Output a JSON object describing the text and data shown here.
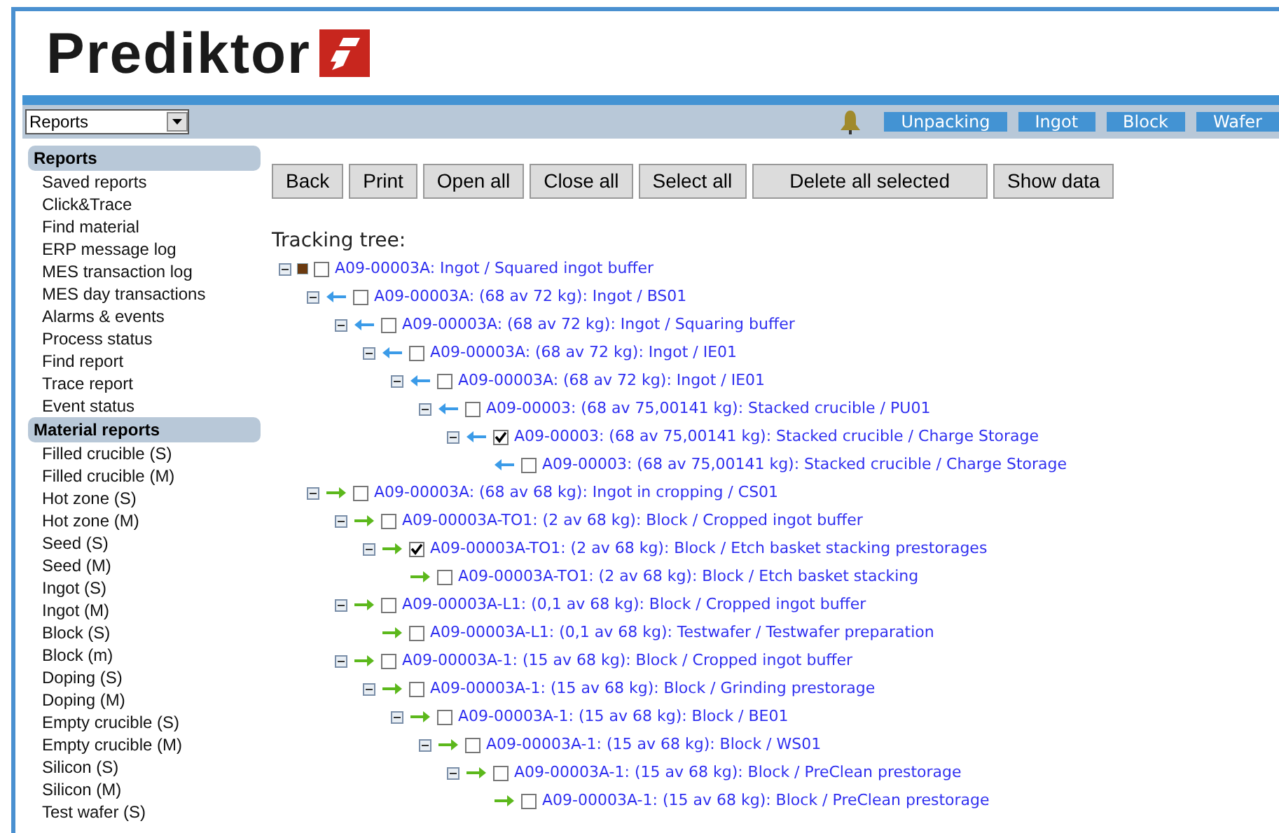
{
  "logo": {
    "text": "Prediktor"
  },
  "view_select": {
    "value": "Reports"
  },
  "nav_tabs": [
    {
      "label": "Unpacking"
    },
    {
      "label": "Ingot"
    },
    {
      "label": "Block"
    },
    {
      "label": "Wafer"
    }
  ],
  "sidebar": {
    "sections": [
      {
        "title": "Reports",
        "items": [
          "Saved reports",
          "Click&Trace",
          "Find material",
          "ERP message log",
          "MES transaction log",
          "MES day transactions",
          "Alarms & events",
          "Process status",
          "Find report",
          "Trace report",
          "Event status"
        ]
      },
      {
        "title": "Material reports",
        "items": [
          "Filled crucible (S)",
          "Filled crucible (M)",
          "Hot zone (S)",
          "Hot zone (M)",
          "Seed (S)",
          "Seed (M)",
          "Ingot (S)",
          "Ingot (M)",
          "Block (S)",
          "Block (m)",
          "Doping (S)",
          "Doping (M)",
          "Empty crucible (S)",
          "Empty crucible (M)",
          "Silicon (S)",
          "Silicon (M)",
          "Test wafer (S)"
        ]
      }
    ]
  },
  "toolbar": [
    "Back",
    "Print",
    "Open all",
    "Close all",
    "Select all",
    "Delete all selected",
    "Show data"
  ],
  "tracking_tree": {
    "title": "Tracking tree:",
    "nodes": [
      {
        "kind": "root",
        "checked": false,
        "label": "A09-00003A: Ingot / Squared ingot buffer",
        "children": [
          {
            "kind": "incoming",
            "checked": false,
            "label": "A09-00003A: (68 av 72 kg): Ingot / BS01",
            "children": [
              {
                "kind": "incoming",
                "checked": false,
                "label": "A09-00003A: (68 av 72 kg): Ingot / Squaring buffer",
                "children": [
                  {
                    "kind": "incoming",
                    "checked": false,
                    "label": "A09-00003A: (68 av 72 kg): Ingot / IE01",
                    "children": [
                      {
                        "kind": "incoming",
                        "checked": false,
                        "label": "A09-00003A: (68 av 72 kg): Ingot / IE01",
                        "children": [
                          {
                            "kind": "incoming",
                            "checked": false,
                            "label": "A09-00003: (68 av 75,00141 kg): Stacked crucible / PU01",
                            "children": [
                              {
                                "kind": "incoming",
                                "checked": true,
                                "label": "A09-00003: (68 av 75,00141 kg): Stacked crucible / Charge Storage",
                                "children": [
                                  {
                                    "kind": "incoming",
                                    "checked": false,
                                    "label": "A09-00003: (68 av 75,00141 kg): Stacked crucible / Charge Storage"
                                  }
                                ]
                              }
                            ]
                          }
                        ]
                      }
                    ]
                  }
                ]
              }
            ]
          },
          {
            "kind": "outgoing",
            "checked": false,
            "label": "A09-00003A: (68 av 68 kg): Ingot in cropping / CS01",
            "children": [
              {
                "kind": "outgoing",
                "checked": false,
                "label": "A09-00003A-TO1: (2 av 68 kg): Block / Cropped ingot buffer",
                "children": [
                  {
                    "kind": "outgoing",
                    "checked": true,
                    "label": "A09-00003A-TO1: (2 av 68 kg): Block / Etch basket stacking prestorages",
                    "children": [
                      {
                        "kind": "outgoing",
                        "checked": false,
                        "label": "A09-00003A-TO1: (2 av 68 kg): Block / Etch basket stacking"
                      }
                    ]
                  }
                ]
              },
              {
                "kind": "outgoing",
                "checked": false,
                "label": "A09-00003A-L1: (0,1 av 68 kg): Block / Cropped ingot buffer",
                "children": [
                  {
                    "kind": "outgoing",
                    "checked": false,
                    "label": "A09-00003A-L1: (0,1 av 68 kg): Testwafer / Testwafer preparation"
                  }
                ]
              },
              {
                "kind": "outgoing",
                "checked": false,
                "label": "A09-00003A-1: (15 av 68 kg): Block / Cropped ingot buffer",
                "children": [
                  {
                    "kind": "outgoing",
                    "checked": false,
                    "label": "A09-00003A-1: (15 av 68 kg): Block / Grinding prestorage",
                    "children": [
                      {
                        "kind": "outgoing",
                        "checked": false,
                        "label": "A09-00003A-1: (15 av 68 kg): Block / BE01",
                        "children": [
                          {
                            "kind": "outgoing",
                            "checked": false,
                            "label": "A09-00003A-1: (15 av 68 kg): Block / WS01",
                            "children": [
                              {
                                "kind": "outgoing",
                                "checked": false,
                                "label": "A09-00003A-1: (15 av 68 kg): Block / PreClean prestorage",
                                "children": [
                                  {
                                    "kind": "outgoing",
                                    "checked": false,
                                    "label": "A09-00003A-1: (15 av 68 kg): Block / PreClean prestorage"
                                  }
                                ]
                              }
                            ]
                          }
                        ]
                      }
                    ]
                  }
                ]
              }
            ]
          }
        ]
      }
    ]
  }
}
